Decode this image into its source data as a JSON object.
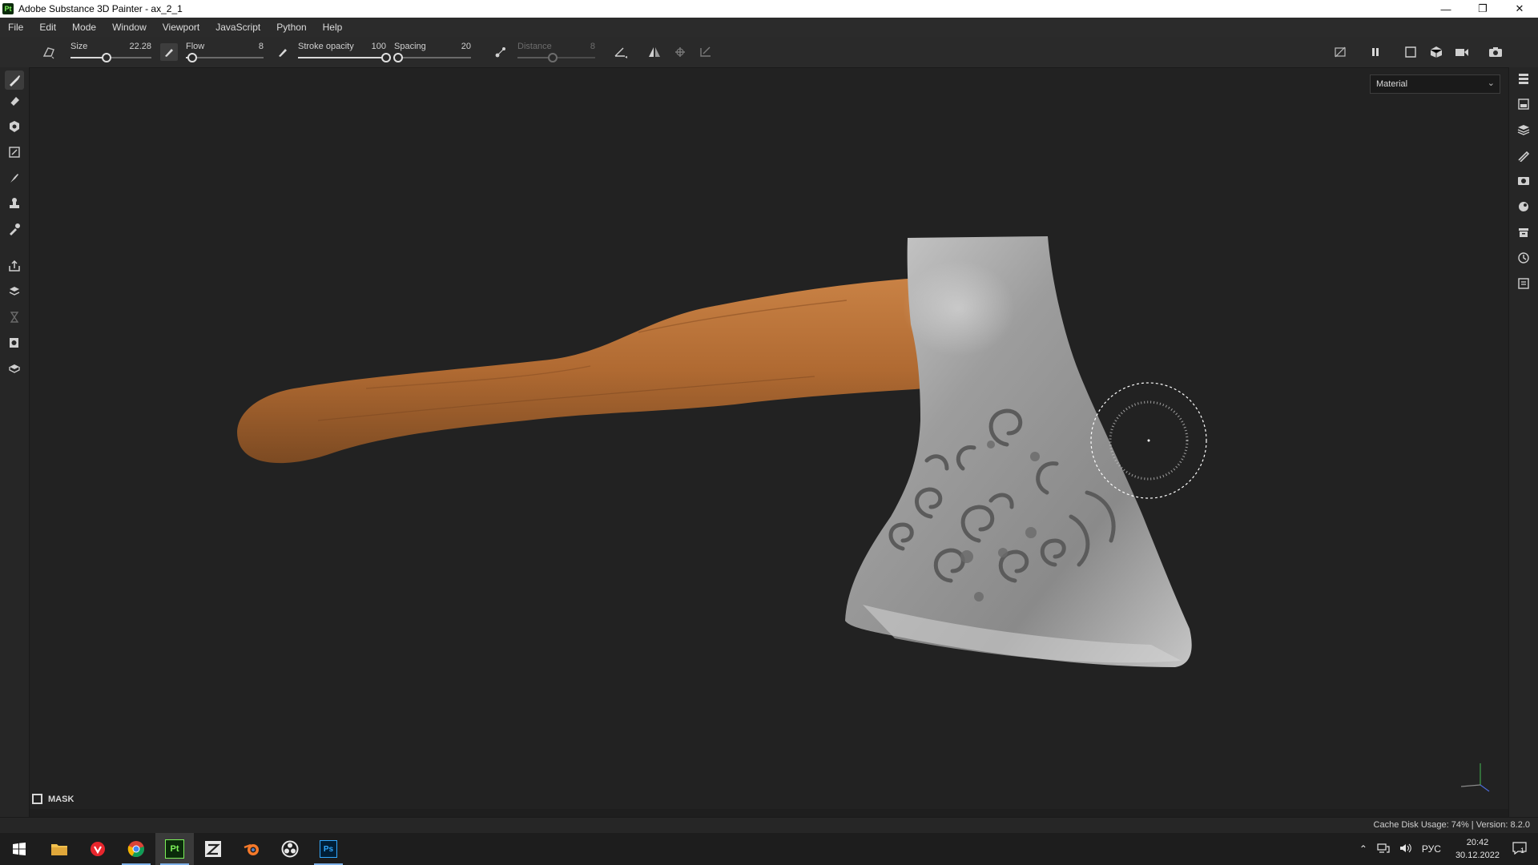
{
  "window": {
    "app_icon": "Pt",
    "title": "Adobe Substance 3D Painter - ax_2_1",
    "controls": [
      "minimize-icon",
      "restore-icon",
      "close-icon"
    ]
  },
  "menu": [
    "File",
    "Edit",
    "Mode",
    "Window",
    "Viewport",
    "JavaScript",
    "Python",
    "Help"
  ],
  "toolbar": {
    "size": {
      "label": "Size",
      "value": "22.28",
      "fraction": 0.45
    },
    "flow": {
      "label": "Flow",
      "value": "8",
      "fraction": 0.08
    },
    "stroke_opacity": {
      "label": "Stroke opacity",
      "value": "100",
      "fraction": 1.0
    },
    "spacing": {
      "label": "Spacing",
      "value": "20",
      "fraction": 0.05
    },
    "distance": {
      "label": "Distance",
      "value": "8",
      "fraction": 0.45,
      "disabled": true
    }
  },
  "viewport": {
    "channel_dropdown": "Material",
    "mask_label": "MASK",
    "accent_colors": {
      "wood": "#b06a32",
      "metal": "#a9a9a9",
      "brush_cursor": "#ffffff"
    }
  },
  "left_tools": [
    "paint-brush-icon",
    "eraser-icon",
    "projection-icon",
    "geometry-mask-icon",
    "smudge-icon",
    "clone-stamp-icon",
    "color-picker-icon",
    "bake-export-icon",
    "polygon-fill-icon",
    "hourglass-icon",
    "stencil-icon",
    "uv-icon"
  ],
  "right_tools": [
    "layers-icon",
    "texture-set-icon",
    "layer-stack-icon",
    "properties-icon",
    "display-settings-icon",
    "shader-settings-icon",
    "assets-icon",
    "history-icon",
    "log-icon"
  ],
  "status": {
    "text": "Cache Disk Usage:   74% | Version: 8.2.0"
  },
  "taskbar": {
    "apps": [
      "windows-start-icon",
      "file-explorer-icon",
      "vivaldi-icon",
      "chrome-icon",
      "substance-painter-icon",
      "zbrush-icon",
      "blender-icon",
      "obs-icon",
      "photoshop-icon"
    ],
    "lang": "РУС",
    "time": "20:42",
    "date": "30.12.2022",
    "notification_count": "1"
  }
}
